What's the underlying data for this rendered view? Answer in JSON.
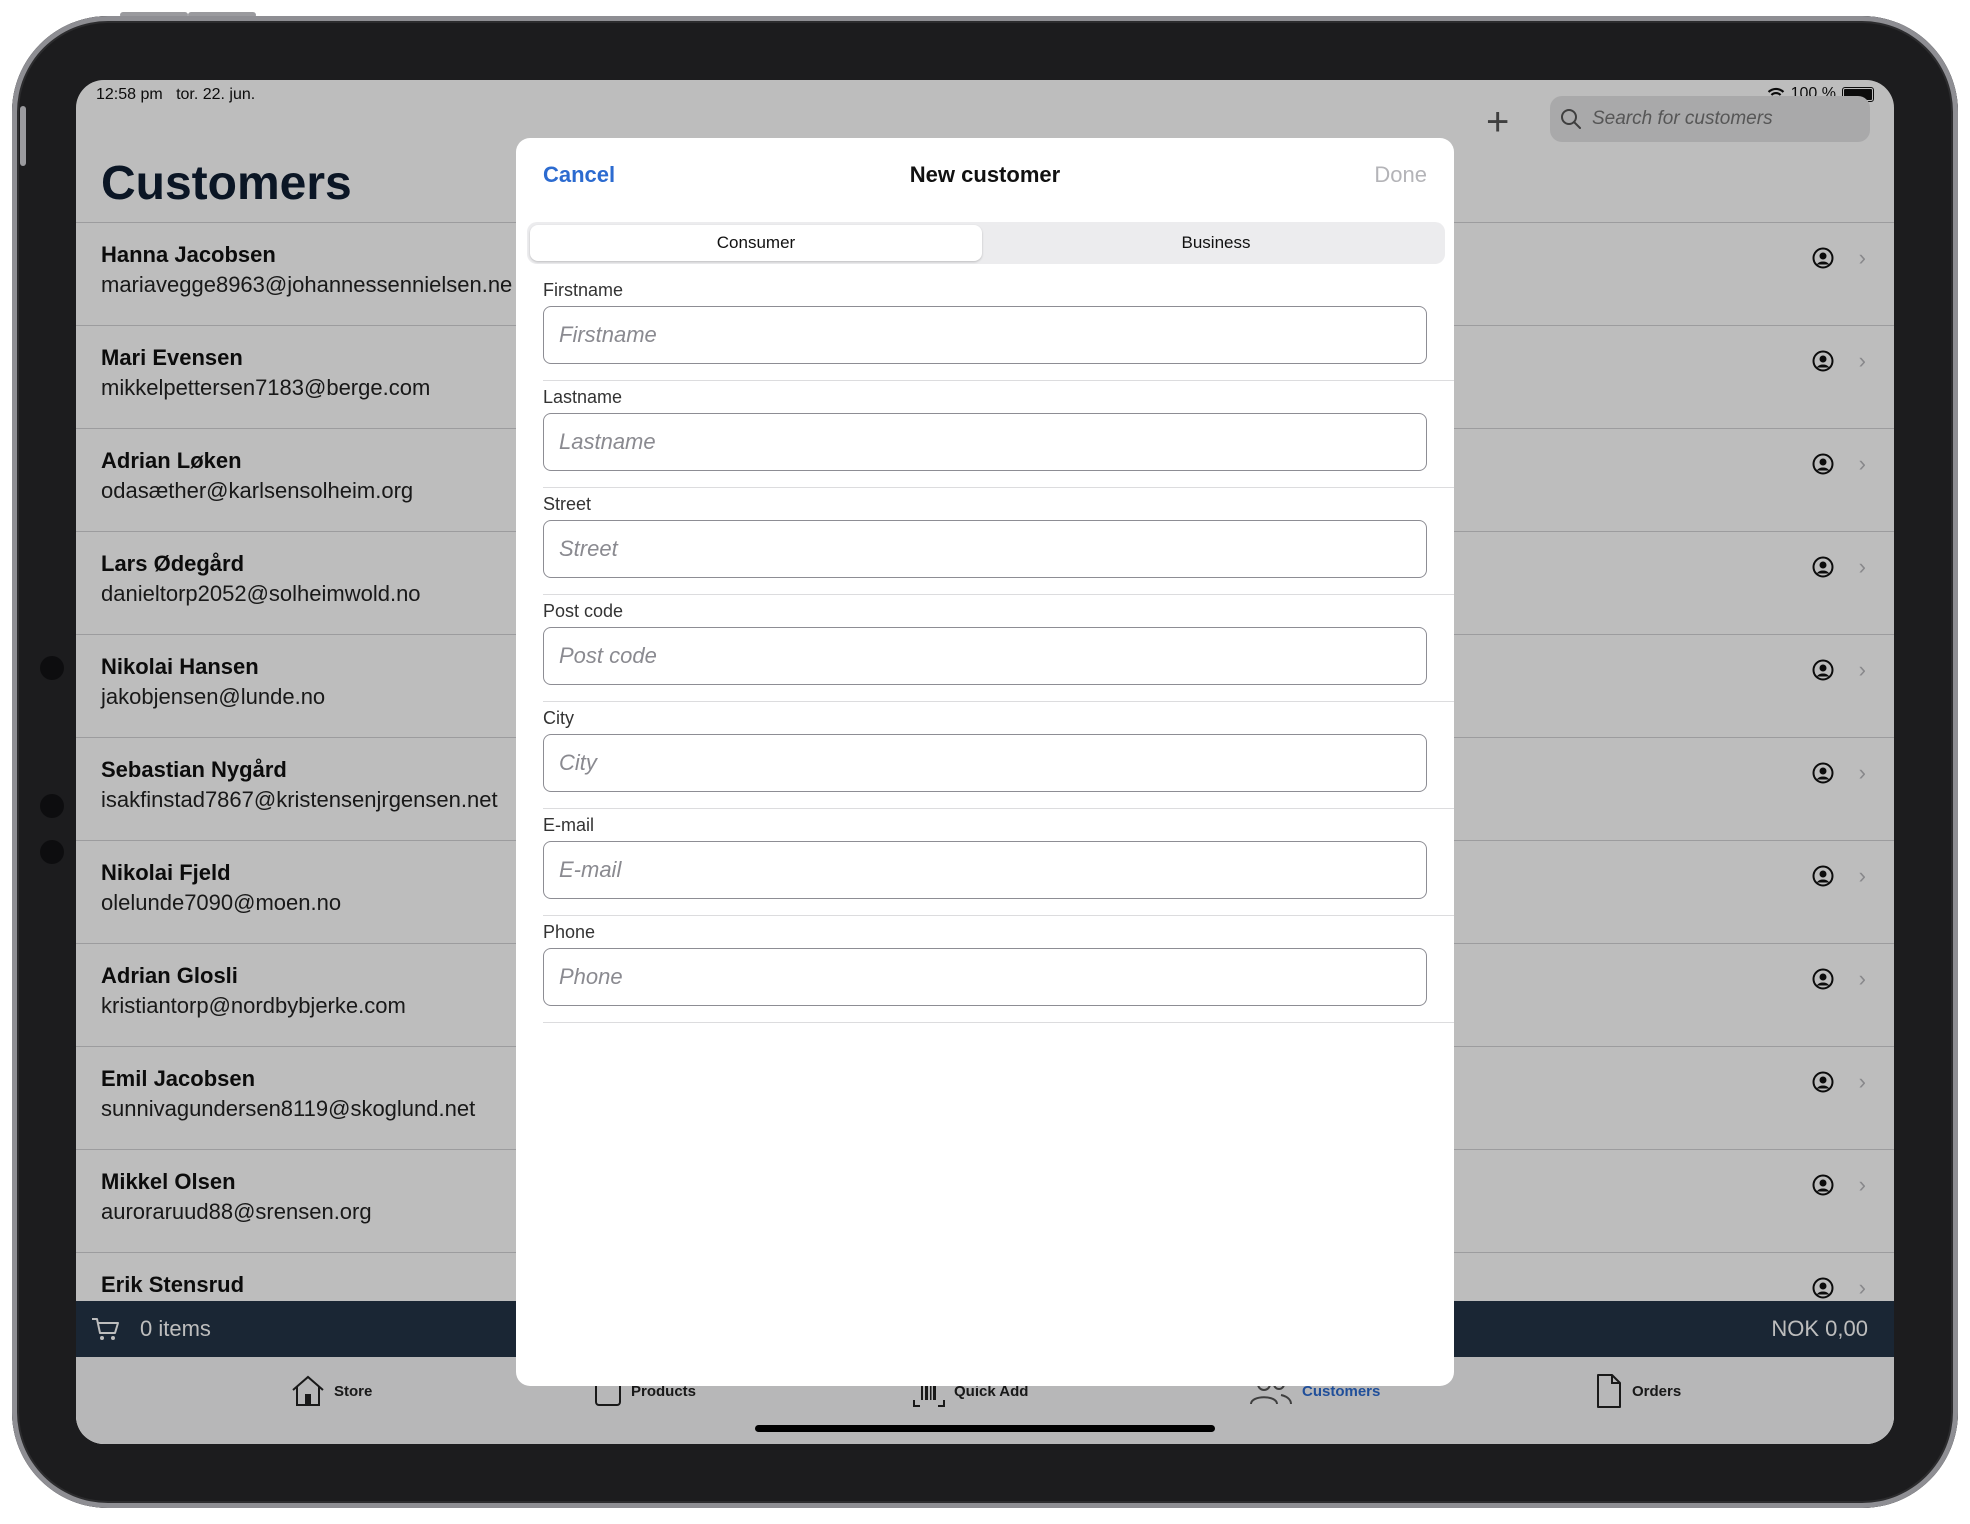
{
  "status": {
    "time": "12:58 pm",
    "date": "tor. 22. jun.",
    "battery": "100 %"
  },
  "search": {
    "placeholder": "Search for customers"
  },
  "page": {
    "title": "Customers",
    "add_icon": "plus-icon"
  },
  "customers": [
    {
      "name": "Hanna Jacobsen",
      "email": "mariavegge8963@johannessennielsen.ne"
    },
    {
      "name": "Mari Evensen",
      "email": "mikkelpettersen7183@berge.com"
    },
    {
      "name": "Adrian Løken",
      "email": "odasæther@karlsensolheim.org"
    },
    {
      "name": "Lars Ødegård",
      "email": "danieltorp2052@solheimwold.no"
    },
    {
      "name": "Nikolai Hansen",
      "email": "jakobjensen@lunde.no"
    },
    {
      "name": "Sebastian Nygård",
      "email": "isakfinstad7867@kristensenjrgensen.net"
    },
    {
      "name": "Nikolai Fjeld",
      "email": "olelunde7090@moen.no"
    },
    {
      "name": "Adrian Glosli",
      "email": "kristiantorp@nordbybjerke.com"
    },
    {
      "name": "Emil Jacobsen",
      "email": "sunnivagundersen8119@skoglund.net"
    },
    {
      "name": "Mikkel Olsen",
      "email": "auroraruud88@srensen.org"
    },
    {
      "name": "Erik Stensrud",
      "email": ""
    }
  ],
  "cart": {
    "items": "0 items",
    "total": "NOK 0,00"
  },
  "tabs": [
    {
      "label": "Store",
      "icon": "home-icon"
    },
    {
      "label": "Products",
      "icon": "products-icon"
    },
    {
      "label": "Quick Add",
      "icon": "barcode-icon"
    },
    {
      "label": "Customers",
      "icon": "customers-icon",
      "active": true
    },
    {
      "label": "Orders",
      "icon": "document-icon"
    }
  ],
  "modal": {
    "title": "New customer",
    "cancel": "Cancel",
    "done": "Done",
    "segments": [
      "Consumer",
      "Business"
    ],
    "selected_segment": "Consumer",
    "fields": [
      {
        "label": "Firstname",
        "placeholder": "Firstname",
        "value": ""
      },
      {
        "label": "Lastname",
        "placeholder": "Lastname",
        "value": ""
      },
      {
        "label": "Street",
        "placeholder": "Street",
        "value": ""
      },
      {
        "label": "Post code",
        "placeholder": "Post code",
        "value": ""
      },
      {
        "label": "City",
        "placeholder": "City",
        "value": ""
      },
      {
        "label": "E-mail",
        "placeholder": "E-mail",
        "value": ""
      },
      {
        "label": "Phone",
        "placeholder": "Phone",
        "value": ""
      }
    ]
  },
  "colors": {
    "accent": "#2c6bd0",
    "navy": "#243447",
    "title": "#0f1e33",
    "done_disabled": "#b4b4b8"
  }
}
